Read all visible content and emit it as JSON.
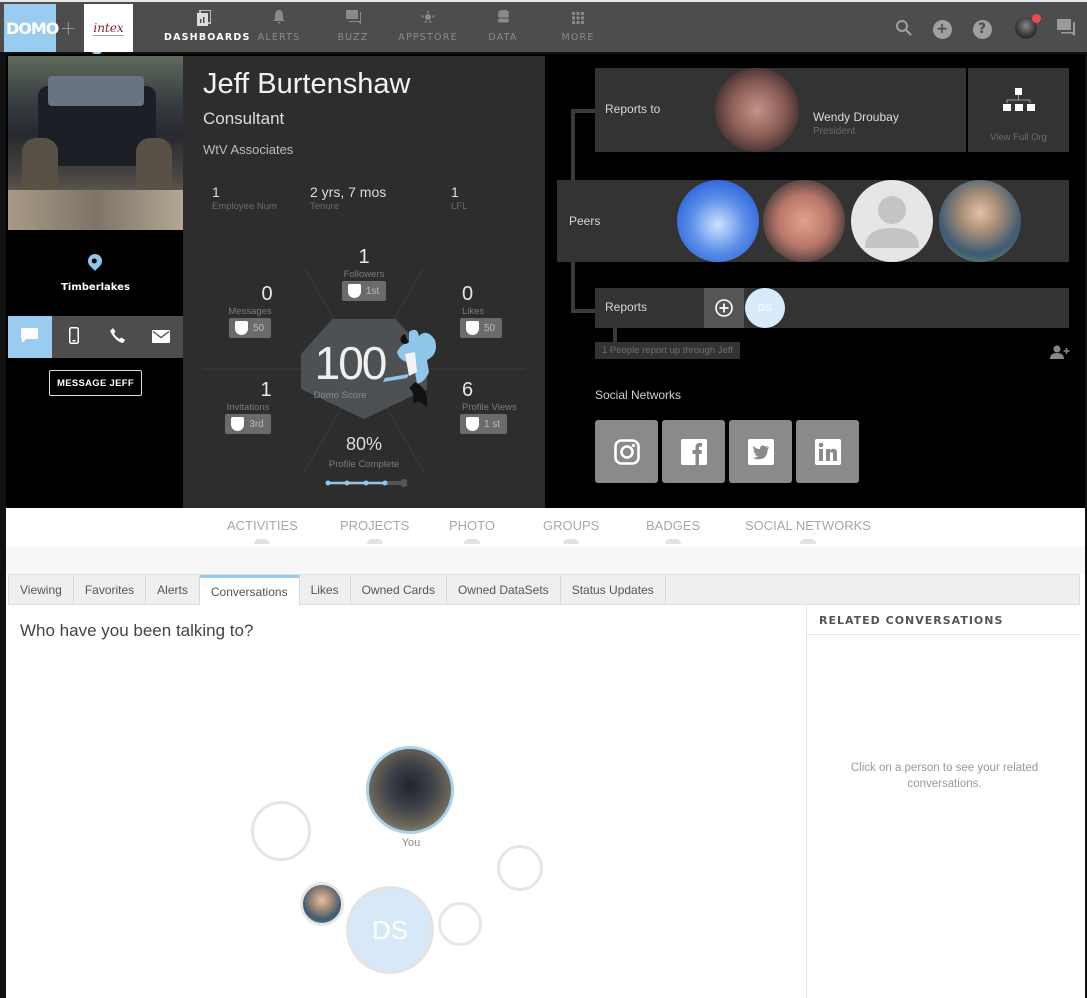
{
  "topnav": {
    "logo": "DOMO",
    "plus": "+",
    "brand": "intex",
    "items": [
      {
        "label": "DASHBOARDS",
        "icon": "dashboards-icon",
        "active": true
      },
      {
        "label": "ALERTS",
        "icon": "bell-icon",
        "active": false
      },
      {
        "label": "BUZZ",
        "icon": "chat-icon",
        "active": false
      },
      {
        "label": "APPSTORE",
        "icon": "appstore-icon",
        "active": false
      },
      {
        "label": "DATA",
        "icon": "database-icon",
        "active": false
      },
      {
        "label": "MORE",
        "icon": "grid-icon",
        "active": false
      }
    ],
    "tools": [
      "search-icon",
      "add-icon",
      "help-icon",
      "avatar",
      "buzz-chat-icon"
    ],
    "help_glyph": "?",
    "add_glyph": "+"
  },
  "profile": {
    "name": "Jeff Burtenshaw",
    "title": "Consultant",
    "company": "WtV Associates",
    "location": "Timberlakes",
    "message_button": "MESSAGE JEFF",
    "contact_methods": [
      "chat",
      "mobile",
      "phone",
      "email"
    ],
    "stats": [
      {
        "value": "1",
        "label": "Employee Num"
      },
      {
        "value": "2 yrs, 7 mos",
        "label": "Tenure"
      },
      {
        "value": "1",
        "label": "LFL"
      }
    ],
    "score": {
      "value": "100",
      "label": "Domo Score",
      "metrics": {
        "followers": {
          "value": "1",
          "label": "Followers",
          "badge": "1st"
        },
        "messages": {
          "value": "0",
          "label": "Messages",
          "badge": "50"
        },
        "likes": {
          "value": "0",
          "label": "Likes",
          "badge": "50"
        },
        "invitations": {
          "value": "1",
          "label": "Invitations",
          "badge": "3rd"
        },
        "profile_views": {
          "value": "6",
          "label": "Profile Views",
          "badge": "1 st"
        }
      },
      "profile_complete": {
        "value": "80%",
        "label": "Profile Complete",
        "steps_done": 4,
        "steps_total": 5
      }
    }
  },
  "org": {
    "reports_to_label": "Reports to",
    "manager": {
      "name": "Wendy Droubay",
      "title": "President"
    },
    "view_full_org": "View Full Org",
    "peers_label": "Peers",
    "peers_count": 4,
    "reports_label": "Reports",
    "report_initials": "DS",
    "report_count_text": "1 People report up through Jeff",
    "social_title": "Social Networks",
    "social": [
      "instagram",
      "facebook",
      "twitter",
      "linkedin"
    ]
  },
  "section_tabs": [
    "ACTIVITIES",
    "PROJECTS",
    "PHOTO",
    "GROUPS",
    "BADGES",
    "SOCIAL NETWORKS"
  ],
  "activity_tabs": {
    "items": [
      "Viewing",
      "Favorites",
      "Alerts",
      "Conversations",
      "Likes",
      "Owned Cards",
      "Owned DataSets",
      "Status Updates"
    ],
    "active": "Conversations"
  },
  "conversations": {
    "title": "Who have you been talking to?",
    "you_label": "You",
    "ds_initials": "DS",
    "related_title": "RELATED CONVERSATIONS",
    "related_empty": "Click on a person to see your related conversations."
  },
  "colors": {
    "accent": "#99ccee",
    "nav_bg": "#4d4d4d",
    "notif": "#e84c4c"
  }
}
